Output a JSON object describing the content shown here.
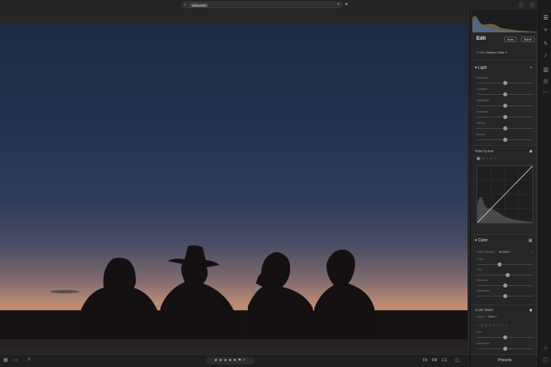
{
  "search": {
    "query": "silhouette"
  },
  "edit": {
    "title": "Edit",
    "auto_label": "Auto",
    "bw_label": "B&W",
    "profile_label": "Profile",
    "profile_value": "Adobe Color"
  },
  "light": {
    "title": "Light",
    "sliders": [
      {
        "label": "Exposure",
        "value": "",
        "level": 0.5
      },
      {
        "label": "Contrast",
        "value": "",
        "level": 0.5
      },
      {
        "label": "Highlights",
        "value": "",
        "level": 0.5
      },
      {
        "label": "Shadows",
        "value": "",
        "level": 0.5
      },
      {
        "label": "Whites",
        "value": "",
        "level": 0.5
      },
      {
        "label": "Blacks",
        "value": "",
        "level": 0.5
      }
    ]
  },
  "tone_curve": {
    "title": "Tone Curve"
  },
  "color": {
    "title": "Color",
    "wb_label": "White Balance",
    "wb_value": "As Shot",
    "sliders": [
      {
        "label": "Temp",
        "value": "",
        "level": 0.4
      },
      {
        "label": "Tint",
        "value": "",
        "level": 0.55
      },
      {
        "label": "Vibrance",
        "value": "",
        "level": 0.5
      },
      {
        "label": "Saturation",
        "value": "",
        "level": 0.5
      }
    ]
  },
  "color_mixer": {
    "title": "Color Mixer",
    "adjust_label": "Adjust",
    "adjust_value": "Color",
    "sliders": [
      {
        "label": "Hue",
        "value": "",
        "level": 0.5
      },
      {
        "label": "Saturation",
        "value": "",
        "level": 0.5
      }
    ],
    "swatches": [
      "#d04040",
      "#e08a3a",
      "#d8c840",
      "#50b050",
      "#40b0b0",
      "#4060d0",
      "#8050c0",
      "#c050a0"
    ]
  },
  "presets_label": "Presets",
  "bottom": {
    "rating": "★ ★ ★ ★ ★",
    "flag": "⚑ ⚐",
    "zoom_fit": "Fit",
    "zoom_fill": "Fill",
    "zoom_11": "1:1"
  },
  "colors": {
    "accent": "#cfcfcf",
    "panel_bg": "#262626",
    "app_bg": "#1e1e1e"
  }
}
